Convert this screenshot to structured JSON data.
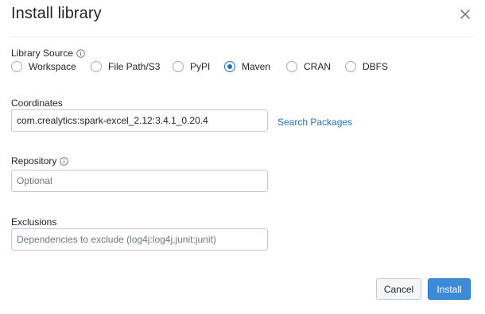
{
  "dialog": {
    "title": "Install library",
    "close_label": "×"
  },
  "library_source": {
    "label": "Library Source",
    "options": [
      {
        "label": "Workspace",
        "checked": false
      },
      {
        "label": "File Path/S3",
        "checked": false
      },
      {
        "label": "PyPI",
        "checked": false
      },
      {
        "label": "Maven",
        "checked": true
      },
      {
        "label": "CRAN",
        "checked": false
      },
      {
        "label": "DBFS",
        "checked": false
      }
    ]
  },
  "coordinates": {
    "label": "Coordinates",
    "value": "com.crealytics:spark-excel_2.12:3.4.1_0.20.4",
    "search_link": "Search Packages"
  },
  "repository": {
    "label": "Repository",
    "placeholder": "Optional"
  },
  "exclusions": {
    "label": "Exclusions",
    "placeholder": "Dependencies to exclude (log4j:log4j,junit:junit)"
  },
  "footer": {
    "cancel_label": "Cancel",
    "install_label": "Install"
  },
  "colors": {
    "accent": "#2272b4",
    "primary_button": "#3b8bd9"
  }
}
